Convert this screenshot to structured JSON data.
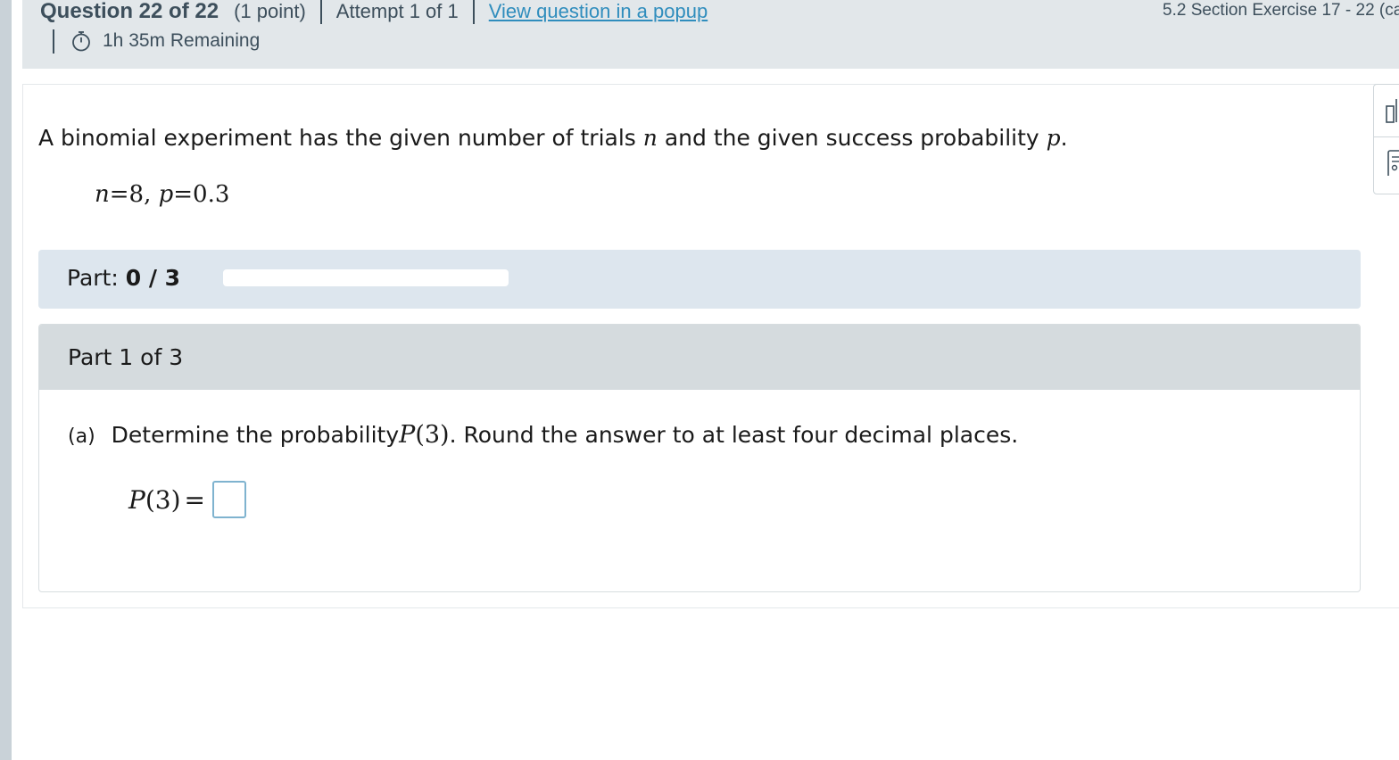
{
  "header": {
    "question_title": "Question 22 of 22",
    "points": "(1 point)",
    "attempt": "Attempt 1 of 1",
    "popup_link": "View question in a popup",
    "timer": "1h 35m Remaining",
    "assignment_title": "5.2 Section Exercise 17 - 22 (ca"
  },
  "problem": {
    "intro_before_n": "A binomial experiment has the given number of trials ",
    "var_n": "n",
    "intro_middle": " and the given success probability ",
    "var_p": "p",
    "intro_end": ".",
    "given_n_var": "n",
    "given_n_eq": "=8, ",
    "given_p_var": "p",
    "given_p_eq": "=0.3"
  },
  "progress": {
    "label": "Part:",
    "value": "0 / 3",
    "fraction": 0
  },
  "part": {
    "header": "Part 1 of 3",
    "tag": "(a)",
    "question_before": "Determine the probability ",
    "question_fn": "P",
    "question_arg": "(3)",
    "question_after": ". Round the answer to at least four decimal places.",
    "answer_fn": "P",
    "answer_arg": "(3)",
    "answer_eq": "=",
    "answer_value": ""
  },
  "icons": {
    "timer": "stopwatch-icon",
    "tool_top": "calculator-icon",
    "tool_bottom": "reference-icon"
  },
  "colors": {
    "header_bg": "#e2e7ea",
    "link": "#2f8dbd",
    "progress_panel": "#dde6ee",
    "part_header": "#d5dbde",
    "input_border": "#7fb3cf"
  }
}
